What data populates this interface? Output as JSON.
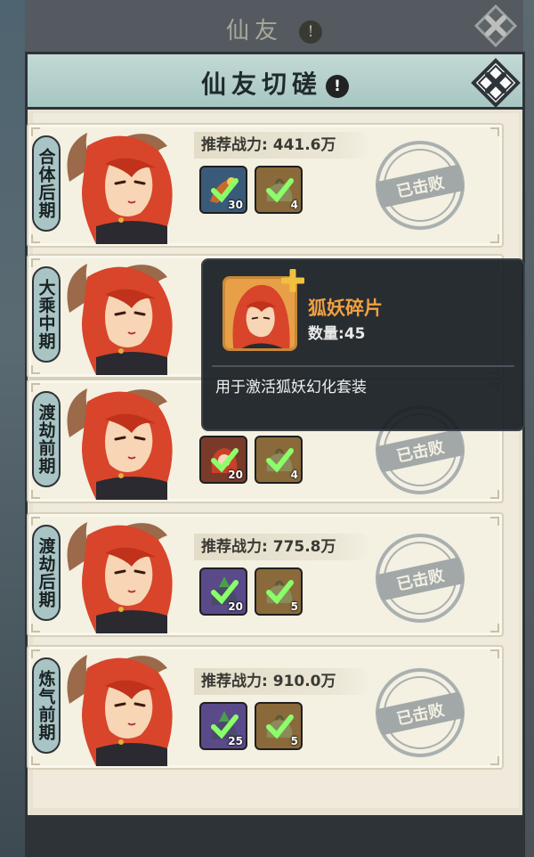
{
  "back_window": {
    "title": "仙友",
    "info_icon": "!"
  },
  "panel": {
    "title": "仙友切磋",
    "info_icon": "!"
  },
  "colors": {
    "header": "#a7c6c2",
    "panel_border": "#2e3338",
    "tooltip_name": "#f0a040",
    "stamp": "#9aa0a0"
  },
  "icons": {
    "close": "close-x-icon",
    "check": "check-icon",
    "defeated_stamp": "defeated-stamp-icon"
  },
  "power_label": "推荐战力:",
  "stamp_text": "已击败",
  "challenges": [
    {
      "stage": "合体后期",
      "power": "441.6万",
      "rewards": [
        {
          "type": "fragment",
          "qty": "30"
        },
        {
          "type": "bag",
          "qty": "4"
        }
      ]
    },
    {
      "stage": "大乘中期",
      "power": "",
      "rewards": []
    },
    {
      "stage": "渡劫前期",
      "power": "",
      "rewards": [
        {
          "type": "fox-fragment",
          "qty": "20"
        },
        {
          "type": "bag",
          "qty": "4"
        }
      ]
    },
    {
      "stage": "渡劫后期",
      "power": "775.8万",
      "rewards": [
        {
          "type": "purple-bag",
          "qty": "20"
        },
        {
          "type": "bag",
          "qty": "5"
        }
      ]
    },
    {
      "stage": "炼气前期",
      "power": "910.0万",
      "rewards": [
        {
          "type": "purple-bag",
          "qty": "25"
        },
        {
          "type": "bag",
          "qty": "5"
        }
      ]
    }
  ],
  "tooltip": {
    "item_name": "狐妖碎片",
    "qty_label": "数量:",
    "qty_value": "45",
    "description": "用于激活狐妖幻化套装"
  }
}
